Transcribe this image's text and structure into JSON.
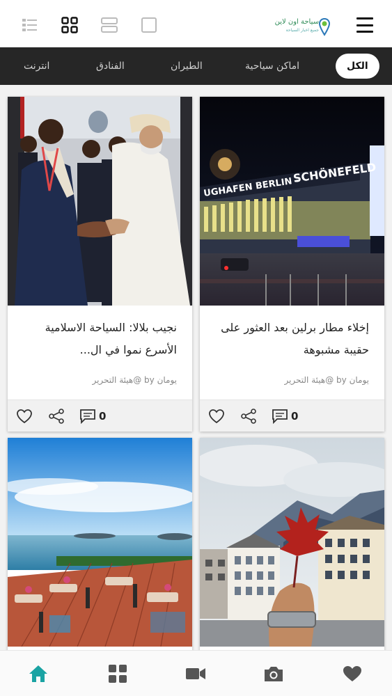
{
  "header": {
    "logo_text": "سياحة اون لاين",
    "logo_sub": "جميع اخبار السياحة",
    "view_icons": [
      "list-view-icon",
      "grid-view-icon",
      "card-view-icon",
      "single-view-icon"
    ],
    "menu_icon": "hamburger-menu-icon"
  },
  "tabs": [
    {
      "label": "الكل",
      "active": true
    },
    {
      "label": "اماكن سياحية",
      "active": false
    },
    {
      "label": "الطيران",
      "active": false
    },
    {
      "label": "الفنادق",
      "active": false
    },
    {
      "label": "انترنت",
      "active": false
    }
  ],
  "cards": [
    {
      "title": "إخلاء مطار برلين بعد العثور على حقيبة مشبوهة",
      "author": "يومان by @هيئة التحرير",
      "comments": "0"
    },
    {
      "title": "نجيب بلالا: السياحة الاسلامية الأسرع نموا في ال...",
      "author": "يومان by @هيئة التحرير",
      "comments": "0"
    },
    {
      "title": "",
      "author": "",
      "comments": ""
    },
    {
      "title": "",
      "author": "",
      "comments": ""
    }
  ],
  "image_texts": {
    "airport_sign": "SCHÖNEFELD",
    "airport_sign_prefix": "UGHAFEN BERLIN -"
  },
  "bottom_nav": [
    {
      "icon": "home-icon",
      "active": true
    },
    {
      "icon": "grid-icon",
      "active": false
    },
    {
      "icon": "video-icon",
      "active": false
    },
    {
      "icon": "camera-icon",
      "active": false
    },
    {
      "icon": "heart-icon",
      "active": false
    }
  ],
  "colors": {
    "accent": "#1aa3a3",
    "tab_bar": "#262626",
    "icon_gray": "#555555"
  }
}
